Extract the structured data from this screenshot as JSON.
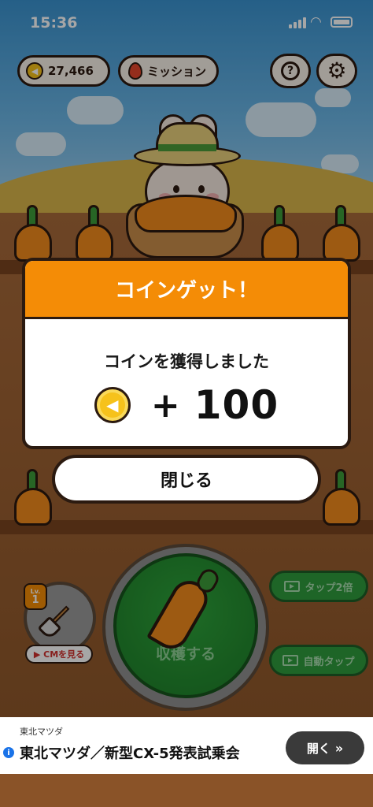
{
  "status_bar": {
    "time": "15:36"
  },
  "hud": {
    "coins": "27,466",
    "mission_label": "ミッション",
    "help_label": "?"
  },
  "modal": {
    "title": "コインゲット！",
    "message": "コインを獲得しました",
    "plus": "+",
    "amount": "100",
    "close_label": "閉じる"
  },
  "controls": {
    "level_prefix": "Lv.",
    "level": "1",
    "cm_label": "▶ CMを見る",
    "harvest_label": "収穫する",
    "tap2x_label": "タップ2倍",
    "auto_tap_label": "自動タップ"
  },
  "ad": {
    "advertiser": "東北マツダ",
    "title": "東北マツダ／新型CX-5発表試乗会",
    "open_label": "開く",
    "info_glyph": "i"
  },
  "colors": {
    "modal_header": "#f48c06",
    "harvest_button": "#2ea43b",
    "coin": "#f6c21b"
  },
  "icons": [
    "coin-icon",
    "flame-icon",
    "help-icon",
    "gear-icon",
    "shovel-icon",
    "carrot-icon",
    "video-icon",
    "chevron-right-icon"
  ]
}
